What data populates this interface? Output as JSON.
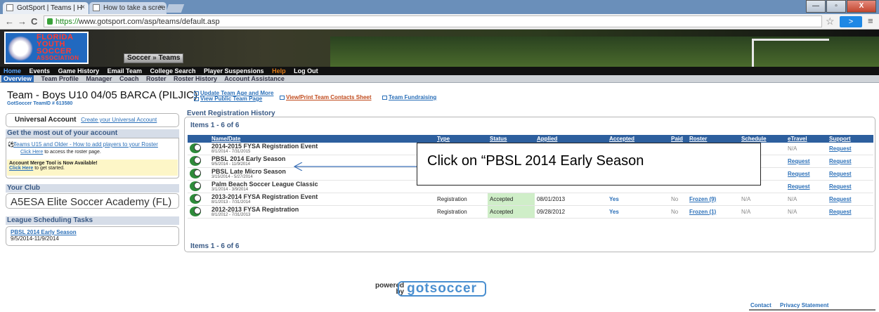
{
  "browser": {
    "tabs": [
      {
        "label": "GotSport | Teams | H",
        "close": "×"
      },
      {
        "label": "How to take a scree",
        "close": "×"
      }
    ],
    "back": "←",
    "forward": "→",
    "reload": "C",
    "url_scheme": "https://",
    "url_rest": "www.gotsport.com/asp/teams/default.asp",
    "star": "☆",
    "ext": ">",
    "menu": "≡",
    "min": "—",
    "max": "▫",
    "close": "X"
  },
  "header": {
    "logo_lines": [
      "FLORIDA",
      "YOUTH",
      "SOCCER",
      "ASSOCIATION"
    ],
    "sport": "Soccer",
    "sep": "»",
    "section": "Teams"
  },
  "mainnav": [
    "Home",
    "Events",
    "Game History",
    "Email Team",
    "College Search",
    "Player Suspensions",
    "Help",
    "Log Out"
  ],
  "subnav": [
    "Overview",
    "Team Profile",
    "Manager",
    "Coach",
    "Roster",
    "Roster History",
    "Account Assistance"
  ],
  "team": {
    "title": "Team -  Boys U10 04/05 BARCA (PILJIC)",
    "id": "GotSoccer TeamID # 613580"
  },
  "toplinks": {
    "update": "Update Team Age and More",
    "public": "View Public Team Page",
    "contacts": "View/Print Team Contacts Sheet",
    "fundraising": "Team Fundraising"
  },
  "universal": {
    "title": "Universal Account",
    "link": "Create your Universal Account"
  },
  "getmost": {
    "title": "Get the most out of your account",
    "link": "Teams U15 and Older - How to add players to your Roster",
    "click": "Click Here",
    "click_rest": " to access the roster page.",
    "merge_title": "Account Merge Tool is Now Available!",
    "merge_link": "Click Here",
    "merge_rest": " to get started."
  },
  "club": {
    "title": "Your Club",
    "name": "A5ESA Elite Soccer Academy (FL)"
  },
  "league": {
    "title": "League Scheduling Tasks",
    "link": "PBSL 2014 Early Season",
    "dates": "9/5/2014-11/9/2014"
  },
  "events": {
    "title": "Event Registration History",
    "items": "Items 1 - 6 of 6",
    "columns": [
      "Name/Date",
      "Type",
      "Status",
      "Applied",
      "Accepted",
      "Paid",
      "Roster",
      "Schedule",
      "eTravel",
      "Support"
    ],
    "rows": [
      {
        "name": "2014-2015 FYSA Registration Event",
        "date": "8/1/2014 - 7/31/2015",
        "type": "",
        "status": "",
        "applied": "",
        "accepted": "",
        "paid": "",
        "roster": "",
        "schedule": "",
        "etravel": "N/A",
        "support": "Request"
      },
      {
        "name": "PBSL 2014 Early Season",
        "date": "9/5/2014 - 11/9/2014",
        "type": "",
        "status": "",
        "applied": "",
        "accepted": "",
        "paid": "",
        "roster": "",
        "schedule": "",
        "etravel": "Request",
        "support": "Request"
      },
      {
        "name": "PBSL Late Micro Season",
        "date": "3/15/2014 - 5/27/2014",
        "type": "",
        "status": "",
        "applied": "",
        "accepted": "",
        "paid": "",
        "roster": "",
        "schedule": "",
        "etravel": "Request",
        "support": "Request"
      },
      {
        "name": "Palm Beach Soccer League Classic",
        "date": "3/1/2014 - 3/9/2014",
        "type": "",
        "status": "",
        "applied": "",
        "accepted": "",
        "paid": "",
        "roster": "",
        "schedule": "",
        "etravel": "Request",
        "support": "Request"
      },
      {
        "name": "2013-2014 FYSA Registration Event",
        "date": "8/1/2013 - 7/31/2014",
        "type": "Registration",
        "status": "Accepted",
        "applied": "08/01/2013",
        "accepted": "Yes",
        "paid": "No",
        "roster": "Frozen (9)",
        "schedule": "N/A",
        "etravel": "N/A",
        "support": "Request"
      },
      {
        "name": "2012-2013 FYSA Registration",
        "date": "8/1/2012 - 7/31/2013",
        "type": "Registration",
        "status": "Accepted",
        "applied": "09/28/2012",
        "accepted": "Yes",
        "paid": "No",
        "roster": "Frozen (1)",
        "schedule": "N/A",
        "etravel": "N/A",
        "support": "Request"
      }
    ]
  },
  "callout": "Click on “PBSL 2014 Early Season",
  "footer": {
    "powered": "powered",
    "by": "by",
    "brand": "gotsoccer",
    "contact": "Contact",
    "privacy": "Privacy Statement"
  }
}
